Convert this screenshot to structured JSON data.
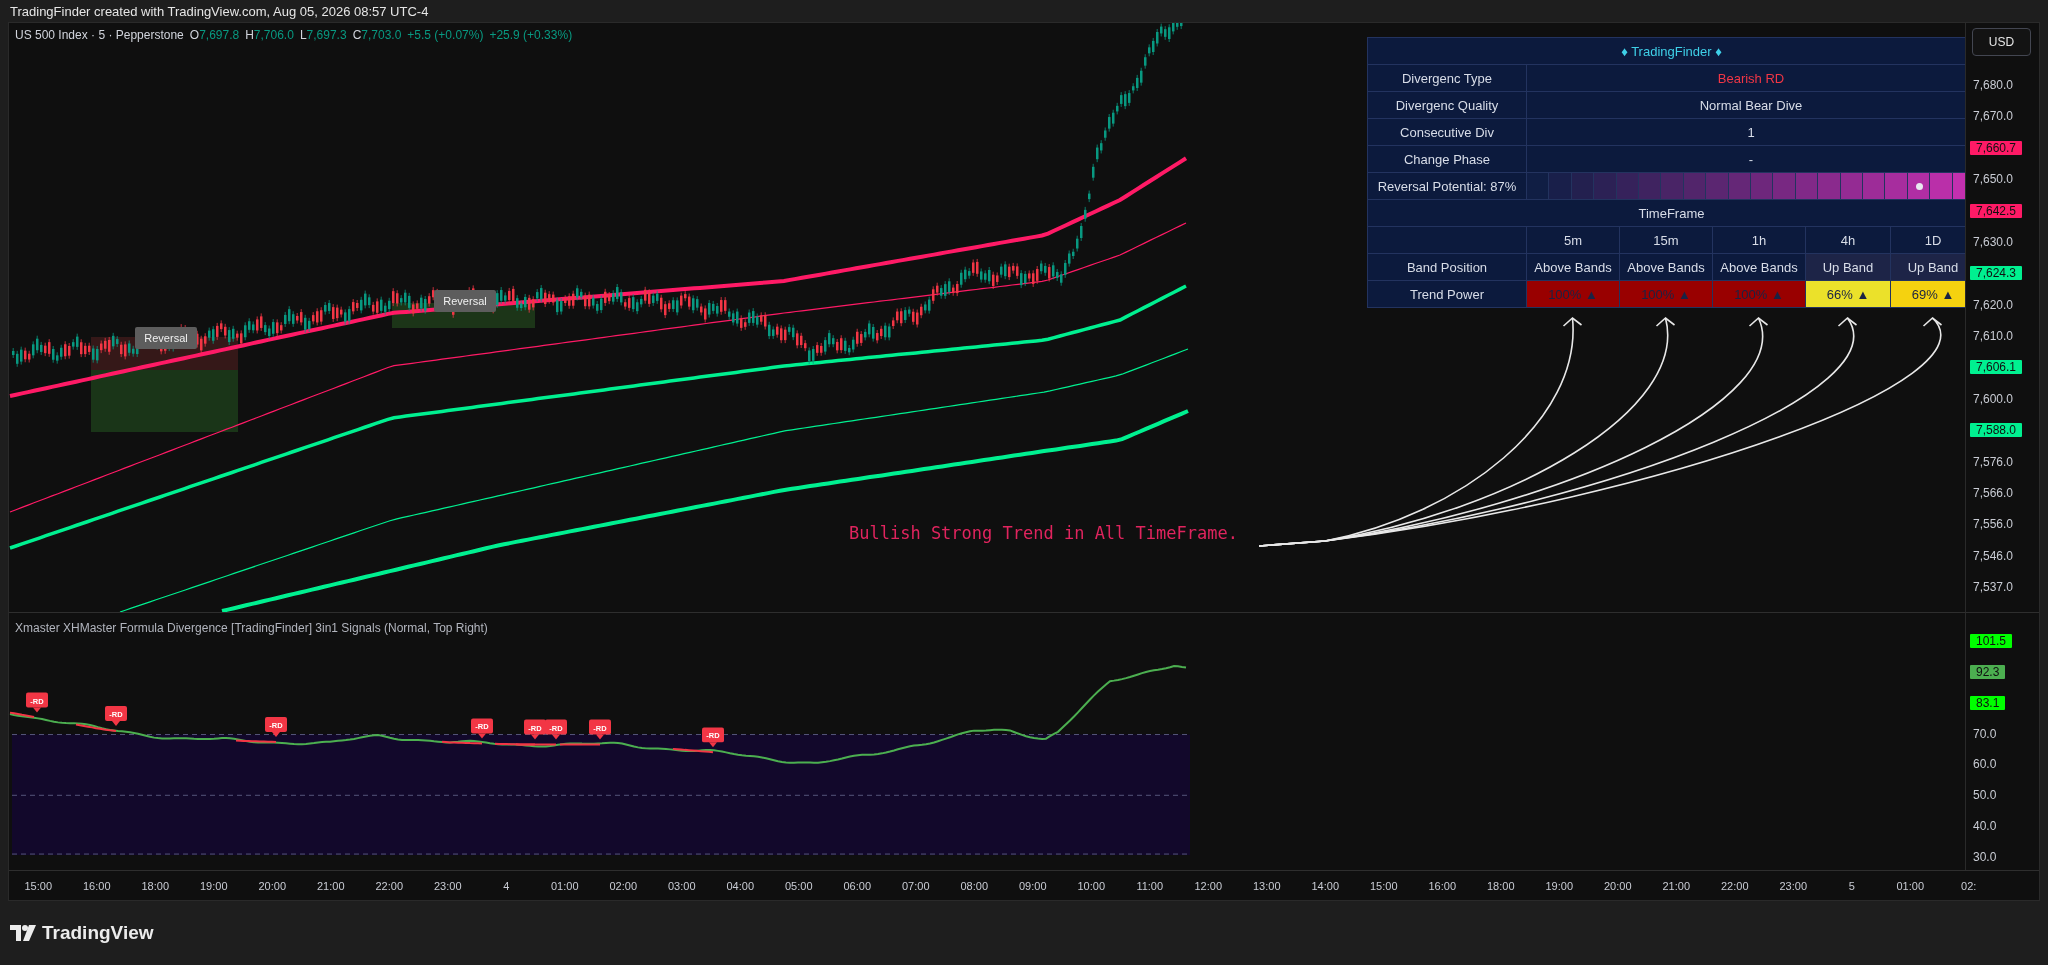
{
  "header": {
    "caption": "TradingFinder created with TradingView.com, Aug 05, 2026 08:57 UTC-4"
  },
  "legend": {
    "symbol": "US 500 Index · 5 · Pepperstone",
    "ohlc": [
      {
        "key": "O",
        "value": "7,697.8"
      },
      {
        "key": "H",
        "value": "7,706.0"
      },
      {
        "key": "L",
        "value": "7,697.3"
      },
      {
        "key": "C",
        "value": "7,703.0"
      }
    ],
    "change": "+5.5 (+0.07%)",
    "change_total": "+25.9 (+0.33%)"
  },
  "chart": {
    "signals": [
      {
        "label": "Reversal"
      },
      {
        "label": "Reversal"
      }
    ],
    "annotation": "Bullish Strong Trend in All TimeFrame."
  },
  "table": {
    "title": "♦ TradingFinder ♦",
    "rows": [
      {
        "label": "Divergenc Type",
        "value": "Bearish RD",
        "color": "#f23645"
      },
      {
        "label": "Divergenc Quality",
        "value": "Normal Bear Dive",
        "color": "#d8dde8"
      },
      {
        "label": "Consecutive Div",
        "value": "1",
        "color": "#d8dde8"
      },
      {
        "label": "Change Phase",
        "value": "-"
      }
    ],
    "reversal": {
      "label": "Reversal Potential: 87%",
      "level": 0.87
    },
    "timeframe_header": "TimeFrame",
    "band_label": "Band Position",
    "power_label": "Trend Power",
    "timeframes": [
      {
        "name": "5m",
        "band": "Above Bands",
        "band_highlight": false,
        "power": "100% ▲",
        "color": "#990000"
      },
      {
        "name": "15m",
        "band": "Above Bands",
        "band_highlight": false,
        "power": "100% ▲",
        "color": "#990000"
      },
      {
        "name": "1h",
        "band": "Above Bands",
        "band_highlight": false,
        "power": "100% ▲",
        "color": "#990000"
      },
      {
        "name": "4h",
        "band": "Up Band",
        "band_highlight": true,
        "power": "66% ▲",
        "color": "#ebe12a"
      },
      {
        "name": "1D",
        "band": "Up Band",
        "band_highlight": true,
        "power": "69% ▲",
        "color": "#f5d20f"
      }
    ]
  },
  "price_axis": {
    "currency": "USD",
    "labels": [
      {
        "text": "7,680.0",
        "kind": "tick"
      },
      {
        "text": "7,670.0",
        "kind": "tick"
      },
      {
        "text": "7,660.7",
        "kind": "badge",
        "color": "#ff1a66"
      },
      {
        "text": "7,650.0",
        "kind": "tick"
      },
      {
        "text": "7,642.5",
        "kind": "badge",
        "color": "#ff1a66"
      },
      {
        "text": "7,630.0",
        "kind": "tick"
      },
      {
        "text": "7,624.3",
        "kind": "badge",
        "color": "#00f090"
      },
      {
        "text": "7,620.0",
        "kind": "tick"
      },
      {
        "text": "7,610.0",
        "kind": "tick"
      },
      {
        "text": "7,606.1",
        "kind": "badge",
        "color": "#00f090"
      },
      {
        "text": "7,600.0",
        "kind": "tick"
      },
      {
        "text": "7,588.0",
        "kind": "badge",
        "color": "#00f090"
      },
      {
        "text": "7,576.0",
        "kind": "tick"
      },
      {
        "text": "7,566.0",
        "kind": "tick"
      },
      {
        "text": "7,556.0",
        "kind": "tick"
      },
      {
        "text": "7,546.0",
        "kind": "tick"
      },
      {
        "text": "7,537.0",
        "kind": "tick"
      }
    ]
  },
  "indicator": {
    "title": "Xmaster XHMaster Formula Divergence [TradingFinder] 3in1 Signals (Normal, Top Right)",
    "markers": [
      {
        "label": "-RD"
      },
      {
        "label": "-RD"
      },
      {
        "label": "-RD"
      },
      {
        "label": "-RD"
      },
      {
        "label": "-RD"
      },
      {
        "label": "-RD"
      },
      {
        "label": "-RD"
      },
      {
        "label": "-RD"
      }
    ],
    "axis": [
      {
        "text": "101.5",
        "kind": "badge",
        "color": "#00ff00"
      },
      {
        "text": "92.3",
        "kind": "badge",
        "color": "#4caf50"
      },
      {
        "text": "83.1",
        "kind": "badge",
        "color": "#00ff00"
      },
      {
        "text": "70.0",
        "kind": "tick"
      },
      {
        "text": "60.0",
        "kind": "tick"
      },
      {
        "text": "50.0",
        "kind": "tick"
      },
      {
        "text": "40.0",
        "kind": "tick"
      },
      {
        "text": "30.0",
        "kind": "tick"
      }
    ]
  },
  "time_axis": [
    "15:00",
    "16:00",
    "18:00",
    "19:00",
    "20:00",
    "21:00",
    "22:00",
    "23:00",
    "4",
    "01:00",
    "02:00",
    "03:00",
    "04:00",
    "05:00",
    "06:00",
    "07:00",
    "08:00",
    "09:00",
    "10:00",
    "11:00",
    "12:00",
    "13:00",
    "14:00",
    "15:00",
    "16:00",
    "18:00",
    "19:00",
    "20:00",
    "21:00",
    "22:00",
    "23:00",
    "5",
    "01:00",
    "02:"
  ],
  "footer": {
    "brand": "TradingView"
  }
}
